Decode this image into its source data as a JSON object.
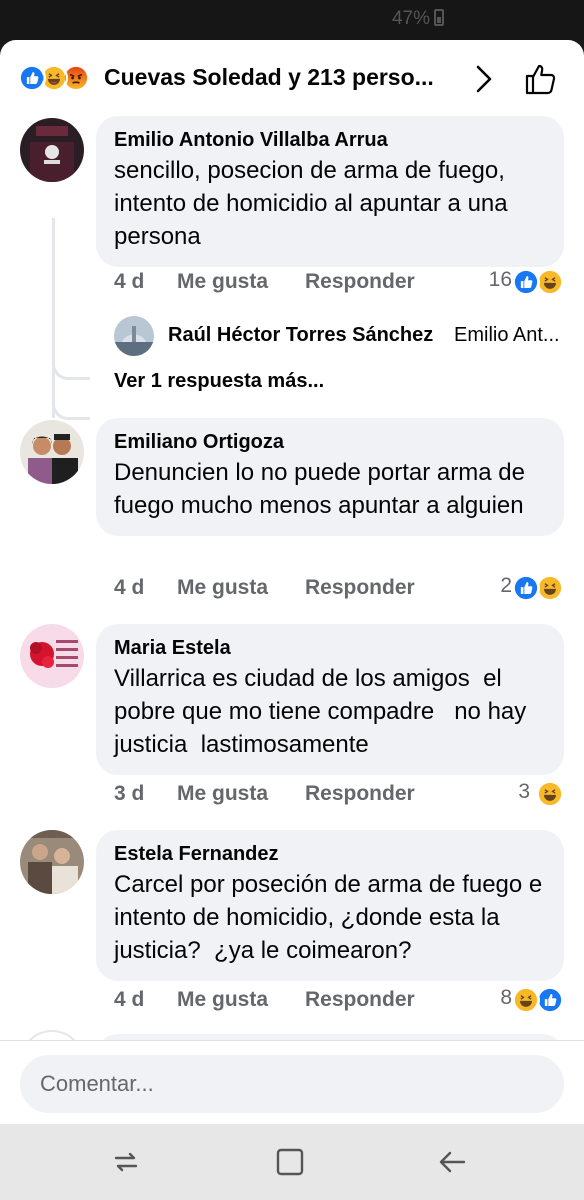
{
  "status_bar": {
    "battery": "47%"
  },
  "header": {
    "title": "Cuevas Soledad y 213 perso...",
    "reaction_icons": [
      "like-icon",
      "haha-icon",
      "angry-icon"
    ]
  },
  "colors": {
    "like": "#1877f2",
    "haha": "#f7b928",
    "angry": "#e9710f",
    "meta_text": "#65676b",
    "bubble": "#f0f2f5"
  },
  "comments": [
    {
      "author": "Emilio Antonio Villalba Arrua",
      "text": "sencillo, posecion de arma de fuego, intento de homicidio al apuntar a una persona",
      "time": "4 d",
      "like_label": "Me gusta",
      "reply_label": "Responder",
      "reaction_count": "16",
      "reactions": [
        "like-icon",
        "haha-icon"
      ]
    },
    {
      "author": "Emiliano Ortigoza",
      "text": "Denuncien lo no puede portar arma de fuego mucho menos apuntar a alguien",
      "time": "4 d",
      "like_label": "Me gusta",
      "reply_label": "Responder",
      "reaction_count": "2",
      "reactions": [
        "like-icon",
        "haha-icon"
      ]
    },
    {
      "author": "Maria Estela",
      "text": "Villarrica es ciudad de los amigos  el pobre que mo tiene compadre   no hay justicia  lastimosamente",
      "time": "3 d",
      "like_label": "Me gusta",
      "reply_label": "Responder",
      "reaction_count": "3",
      "reactions": [
        "haha-icon"
      ]
    },
    {
      "author": "Estela Fernandez",
      "text": "Carcel por poseción de arma de fuego e intento de homicidio, ¿donde esta la justicia?  ¿ya le coimearon?",
      "time": "4 d",
      "like_label": "Me gusta",
      "reply_label": "Responder",
      "reaction_count": "8",
      "reactions": [
        "haha-icon",
        "like-icon"
      ]
    }
  ],
  "reply_preview": {
    "author": "Raúl Héctor Torres Sánchez",
    "snippet": "Emilio Ant..."
  },
  "more_replies": "Ver 1 respuesta más...",
  "composer": {
    "placeholder": "Comentar..."
  },
  "nav_icons": [
    "recents-icon",
    "home-icon",
    "back-icon"
  ]
}
